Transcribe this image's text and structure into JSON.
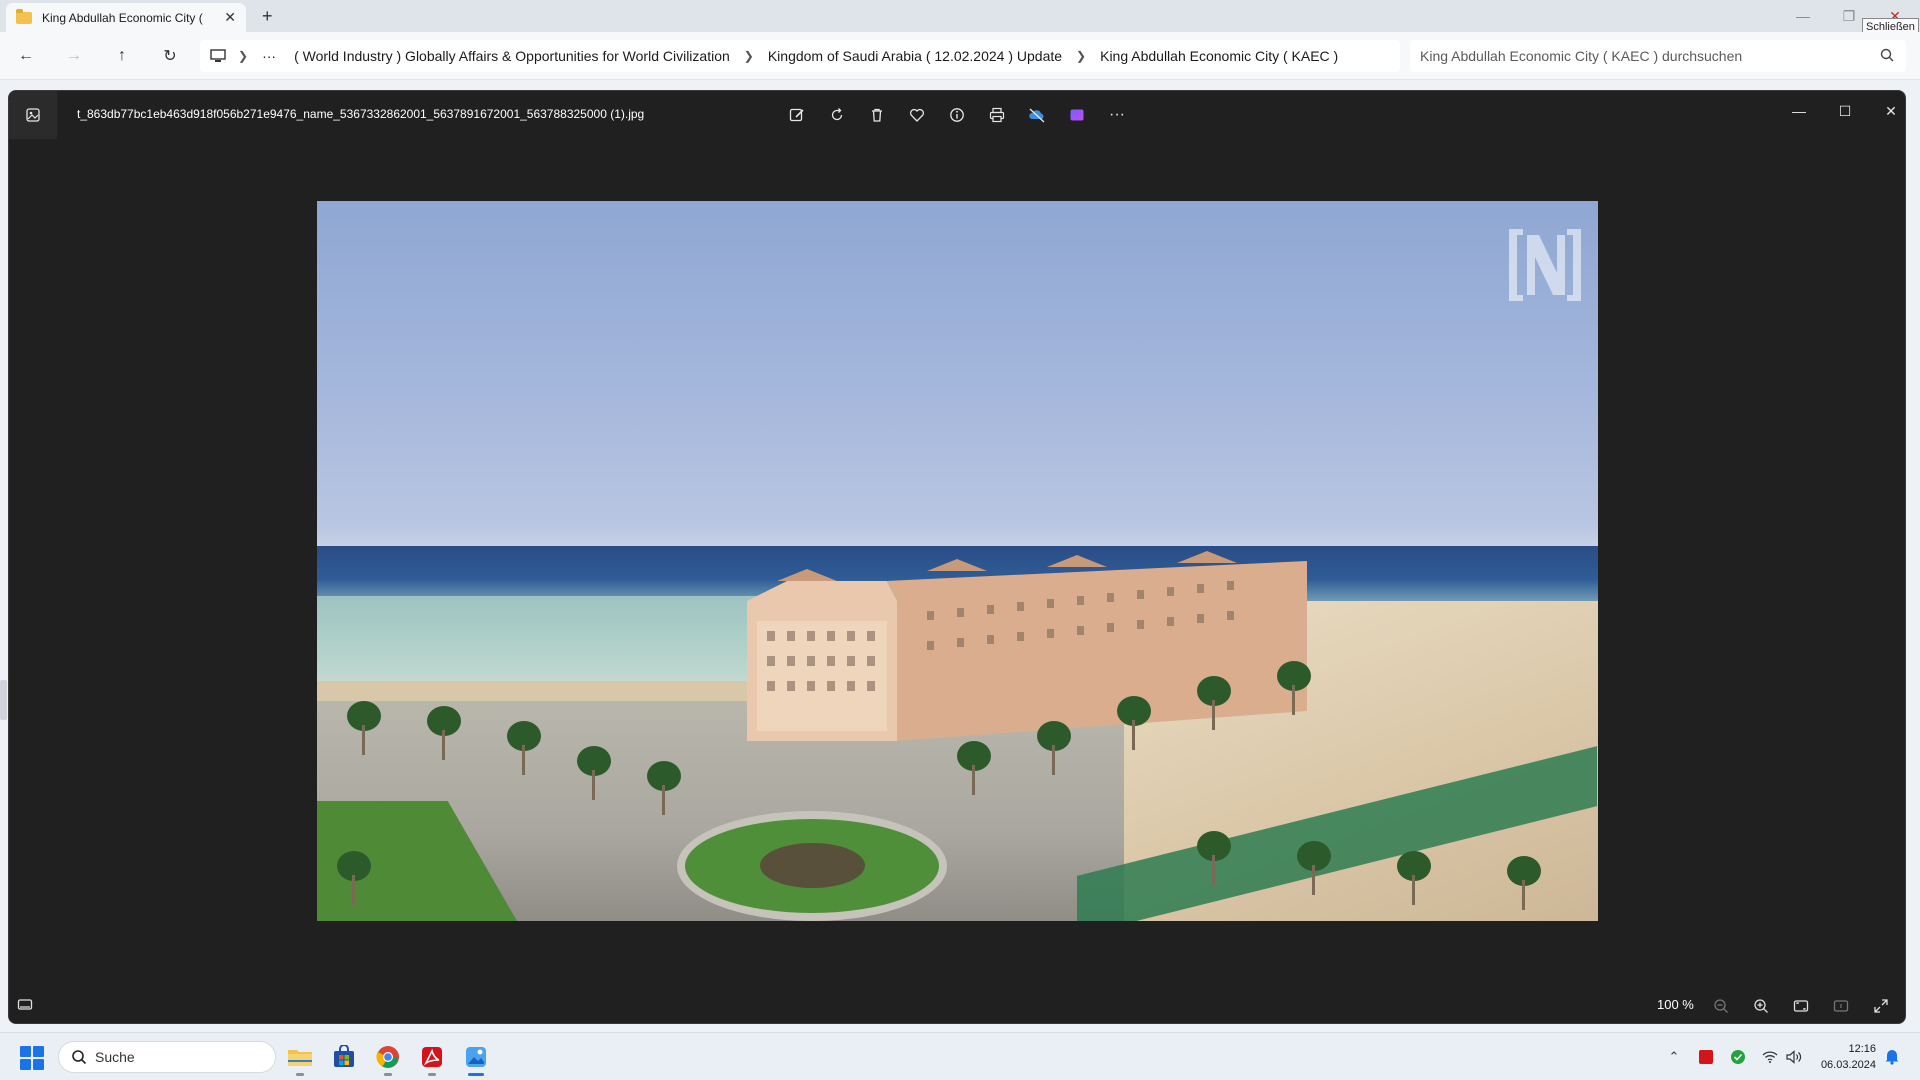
{
  "explorer": {
    "tab_title": "King Abdullah Economic City (",
    "tab_close": "✕",
    "new_tab": "+",
    "tooltip": "Schließen",
    "breadcrumbs": [
      "( World Industry ) Globally Affairs & Opportunities for World Civilization",
      "Kingdom of Saudi Arabia ( 12.02.2024 ) Update",
      "King Abdullah Economic City ( KAEC )"
    ],
    "overflow": "···",
    "search_placeholder": "King Abdullah Economic City ( KAEC ) durchsuchen"
  },
  "viewer": {
    "filename": "t_863db77bc1eb463d918f056b271e9476_name_5367332862001_5637891672001_563788325000 (1).jpg",
    "zoom_level": "100 %",
    "more_label": "···"
  },
  "photo": {
    "description_icons": [
      "watermark-logo"
    ]
  },
  "taskbar": {
    "search_label": "Suche",
    "time": "12:16",
    "date": "06.03.2024",
    "accent": "#1a73e8"
  }
}
